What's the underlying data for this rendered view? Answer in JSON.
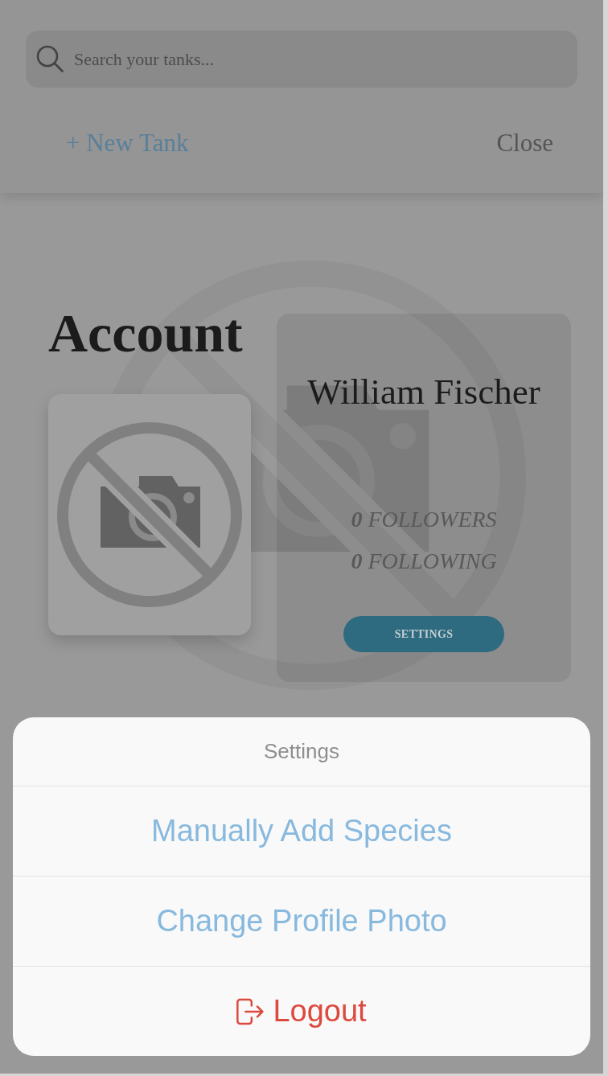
{
  "search": {
    "placeholder": "Search your tanks..."
  },
  "header_actions": [
    {
      "label": "+ New Tank",
      "kind": "primary"
    },
    {
      "label": "Close",
      "kind": "secondary"
    }
  ],
  "page": {
    "title": "Account"
  },
  "profile": {
    "name": "William Fischer",
    "stats": [
      "**0** FOLLOWERS",
      "**0** FOLLOWING"
    ],
    "button": "SETTINGS"
  },
  "action_sheet": {
    "title": "Settings",
    "options": [
      {
        "label": "Manually Add Species",
        "kind": "action"
      },
      {
        "label": "Change Profile Photo",
        "kind": "action"
      },
      {
        "label": "Logout",
        "kind": "logout"
      }
    ]
  }
}
